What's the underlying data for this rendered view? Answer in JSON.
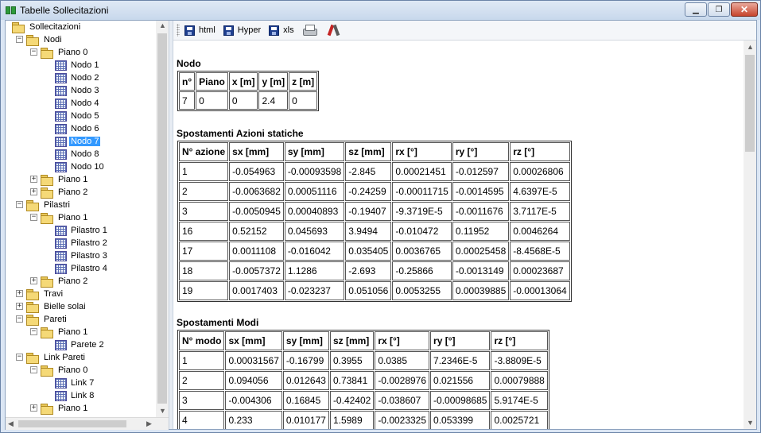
{
  "window": {
    "title": "Tabelle Sollecitazioni",
    "min": "▁",
    "max": "❐",
    "close": "✕"
  },
  "toolbar": {
    "html": "html",
    "hyper": "Hyper",
    "xls": "xls"
  },
  "tree": [
    {
      "label": "Sollecitazioni",
      "level": 0,
      "icon": "folder",
      "exp": ""
    },
    {
      "label": "Nodi",
      "level": 1,
      "icon": "folder",
      "exp": "-"
    },
    {
      "label": "Piano 0",
      "level": 2,
      "icon": "folder",
      "exp": "-"
    },
    {
      "label": "Nodo 1",
      "level": 3,
      "icon": "grid",
      "exp": ""
    },
    {
      "label": "Nodo 2",
      "level": 3,
      "icon": "grid",
      "exp": ""
    },
    {
      "label": "Nodo 3",
      "level": 3,
      "icon": "grid",
      "exp": ""
    },
    {
      "label": "Nodo 4",
      "level": 3,
      "icon": "grid",
      "exp": ""
    },
    {
      "label": "Nodo 5",
      "level": 3,
      "icon": "grid",
      "exp": ""
    },
    {
      "label": "Nodo 6",
      "level": 3,
      "icon": "grid",
      "exp": ""
    },
    {
      "label": "Nodo 7",
      "level": 3,
      "icon": "grid",
      "exp": "",
      "selected": true
    },
    {
      "label": "Nodo 8",
      "level": 3,
      "icon": "grid",
      "exp": ""
    },
    {
      "label": "Nodo 10",
      "level": 3,
      "icon": "grid",
      "exp": ""
    },
    {
      "label": "Piano 1",
      "level": 2,
      "icon": "folder",
      "exp": "+"
    },
    {
      "label": "Piano 2",
      "level": 2,
      "icon": "folder",
      "exp": "+"
    },
    {
      "label": "Pilastri",
      "level": 1,
      "icon": "folder",
      "exp": "-"
    },
    {
      "label": "Piano 1",
      "level": 2,
      "icon": "folder",
      "exp": "-"
    },
    {
      "label": "Pilastro 1",
      "level": 3,
      "icon": "grid",
      "exp": ""
    },
    {
      "label": "Pilastro 2",
      "level": 3,
      "icon": "grid",
      "exp": ""
    },
    {
      "label": "Pilastro 3",
      "level": 3,
      "icon": "grid",
      "exp": ""
    },
    {
      "label": "Pilastro 4",
      "level": 3,
      "icon": "grid",
      "exp": ""
    },
    {
      "label": "Piano 2",
      "level": 2,
      "icon": "folder",
      "exp": "+"
    },
    {
      "label": "Travi",
      "level": 1,
      "icon": "folder",
      "exp": "+"
    },
    {
      "label": "Bielle solai",
      "level": 1,
      "icon": "folder",
      "exp": "+"
    },
    {
      "label": "Pareti",
      "level": 1,
      "icon": "folder",
      "exp": "-"
    },
    {
      "label": "Piano 1",
      "level": 2,
      "icon": "folder",
      "exp": "-"
    },
    {
      "label": "Parete 2",
      "level": 3,
      "icon": "grid",
      "exp": ""
    },
    {
      "label": "Link Pareti",
      "level": 1,
      "icon": "folder",
      "exp": "-"
    },
    {
      "label": "Piano 0",
      "level": 2,
      "icon": "folder",
      "exp": "-"
    },
    {
      "label": "Link 7",
      "level": 3,
      "icon": "grid",
      "exp": ""
    },
    {
      "label": "Link 8",
      "level": 3,
      "icon": "grid",
      "exp": ""
    },
    {
      "label": "Piano 1",
      "level": 2,
      "icon": "folder",
      "exp": "+"
    }
  ],
  "nodo": {
    "title": "Nodo",
    "headers": [
      "n°",
      "Piano",
      "x [m]",
      "y [m]",
      "z [m]"
    ],
    "rows": [
      [
        "7",
        "0",
        "0",
        "2.4",
        "0"
      ]
    ]
  },
  "statiche": {
    "title": "Spostamenti Azioni statiche",
    "headers": [
      "N° azione",
      "sx [mm]",
      "sy [mm]",
      "sz [mm]",
      "rx [°]",
      "ry [°]",
      "rz [°]"
    ],
    "rows": [
      [
        "1",
        "-0.054963",
        "-0.00093598",
        "-2.845",
        "0.00021451",
        "-0.012597",
        "0.00026806"
      ],
      [
        "2",
        "-0.0063682",
        "0.00051116",
        "-0.24259",
        "-0.00011715",
        "-0.0014595",
        "4.6397E-5"
      ],
      [
        "3",
        "-0.0050945",
        "0.00040893",
        "-0.19407",
        "-9.3719E-5",
        "-0.0011676",
        "3.7117E-5"
      ],
      [
        "16",
        "0.52152",
        "0.045693",
        "3.9494",
        "-0.010472",
        "0.11952",
        "0.0046264"
      ],
      [
        "17",
        "0.0011108",
        "-0.016042",
        "0.035405",
        "0.0036765",
        "0.00025458",
        "-8.4568E-5"
      ],
      [
        "18",
        "-0.0057372",
        "1.1286",
        "-2.693",
        "-0.25866",
        "-0.0013149",
        "0.00023687"
      ],
      [
        "19",
        "0.0017403",
        "-0.023237",
        "0.051056",
        "0.0053255",
        "0.00039885",
        "-0.00013064"
      ]
    ]
  },
  "modi": {
    "title": "Spostamenti Modi",
    "headers": [
      "N° modo",
      "sx [mm]",
      "sy [mm]",
      "sz [mm]",
      "rx [°]",
      "ry [°]",
      "rz [°]"
    ],
    "rows": [
      [
        "1",
        "0.00031567",
        "-0.16799",
        "0.3955",
        "0.0385",
        "7.2346E-5",
        "-3.8809E-5"
      ],
      [
        "2",
        "0.094056",
        "0.012643",
        "0.73841",
        "-0.0028976",
        "0.021556",
        "0.00079888"
      ],
      [
        "3",
        "-0.004306",
        "0.16845",
        "-0.42402",
        "-0.038607",
        "-0.00098685",
        "5.9174E-5"
      ],
      [
        "4",
        "0.233",
        "0.010177",
        "1.5989",
        "-0.0023325",
        "0.053399",
        "0.0025721"
      ]
    ]
  }
}
